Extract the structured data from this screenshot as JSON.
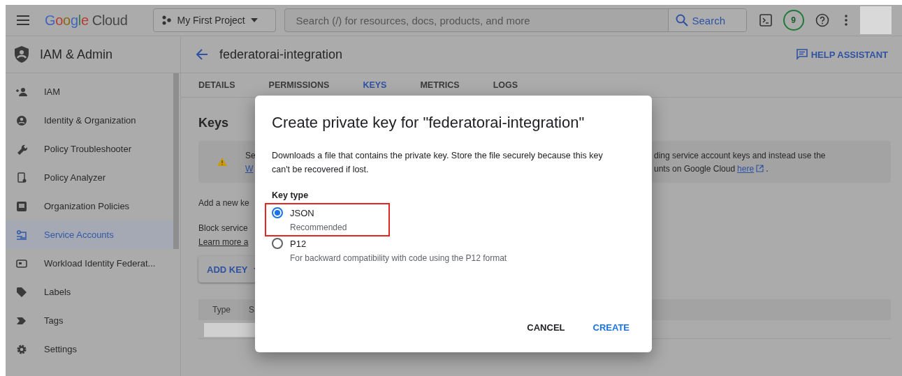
{
  "topbar": {
    "logo": {
      "brand": "Google",
      "product": "Cloud"
    },
    "project": "My First Project",
    "search": {
      "placeholder": "Search (/) for resources, docs, products, and more"
    },
    "search_button": "Search",
    "notifications": "9"
  },
  "sidebar": {
    "title": "IAM & Admin",
    "items": [
      {
        "label": "IAM",
        "kind": "person-add",
        "selected": false
      },
      {
        "label": "Identity & Organization",
        "kind": "account",
        "selected": false
      },
      {
        "label": "Policy Troubleshooter",
        "kind": "wrench",
        "selected": false
      },
      {
        "label": "Policy Analyzer",
        "kind": "document",
        "selected": false
      },
      {
        "label": "Organization Policies",
        "kind": "square",
        "selected": false
      },
      {
        "label": "Service Accounts",
        "kind": "service",
        "selected": true
      },
      {
        "label": "Workload Identity Federat...",
        "kind": "card",
        "selected": false
      },
      {
        "label": "Labels",
        "kind": "tag",
        "selected": false
      },
      {
        "label": "Tags",
        "kind": "chevron",
        "selected": false
      },
      {
        "label": "Settings",
        "kind": "gear",
        "selected": false
      }
    ]
  },
  "page": {
    "title": "federatorai-integration",
    "help_assistant": "HELP ASSISTANT",
    "tabs": [
      {
        "label": "DETAILS",
        "selected": false
      },
      {
        "label": "PERMISSIONS",
        "selected": false
      },
      {
        "label": "KEYS",
        "selected": true
      },
      {
        "label": "METRICS",
        "selected": false
      },
      {
        "label": "LOGS",
        "selected": false
      }
    ],
    "heading": "Keys",
    "warning": {
      "line_1_start": "Se",
      "line_2_start": "W",
      "line_1_end": "ding service account keys and instead use the",
      "line_2_end": "unts on Google Cloud",
      "link": "here",
      "trailing": "."
    },
    "add_key_text": "Add a new ke",
    "block_text": "Block service",
    "learn_more": "Learn more a",
    "add_key_button": "ADD KEY",
    "table": {
      "columns": [
        "Type",
        "S"
      ]
    }
  },
  "dialog": {
    "title": "Create private key for \"federatorai-integration\"",
    "description": "Downloads a file that contains the private key. Store the file securely because this key can't be recovered if lost.",
    "field_label": "Key type",
    "options": [
      {
        "label": "JSON",
        "hint": "Recommended",
        "selected": true,
        "highlighted": true
      },
      {
        "label": "P12",
        "hint": "For backward compatibility with code using the P12 format",
        "selected": false,
        "highlighted": false
      }
    ],
    "buttons": [
      {
        "label": "CANCEL",
        "kind": "secondary"
      },
      {
        "label": "CREATE",
        "kind": "primary"
      }
    ]
  }
}
